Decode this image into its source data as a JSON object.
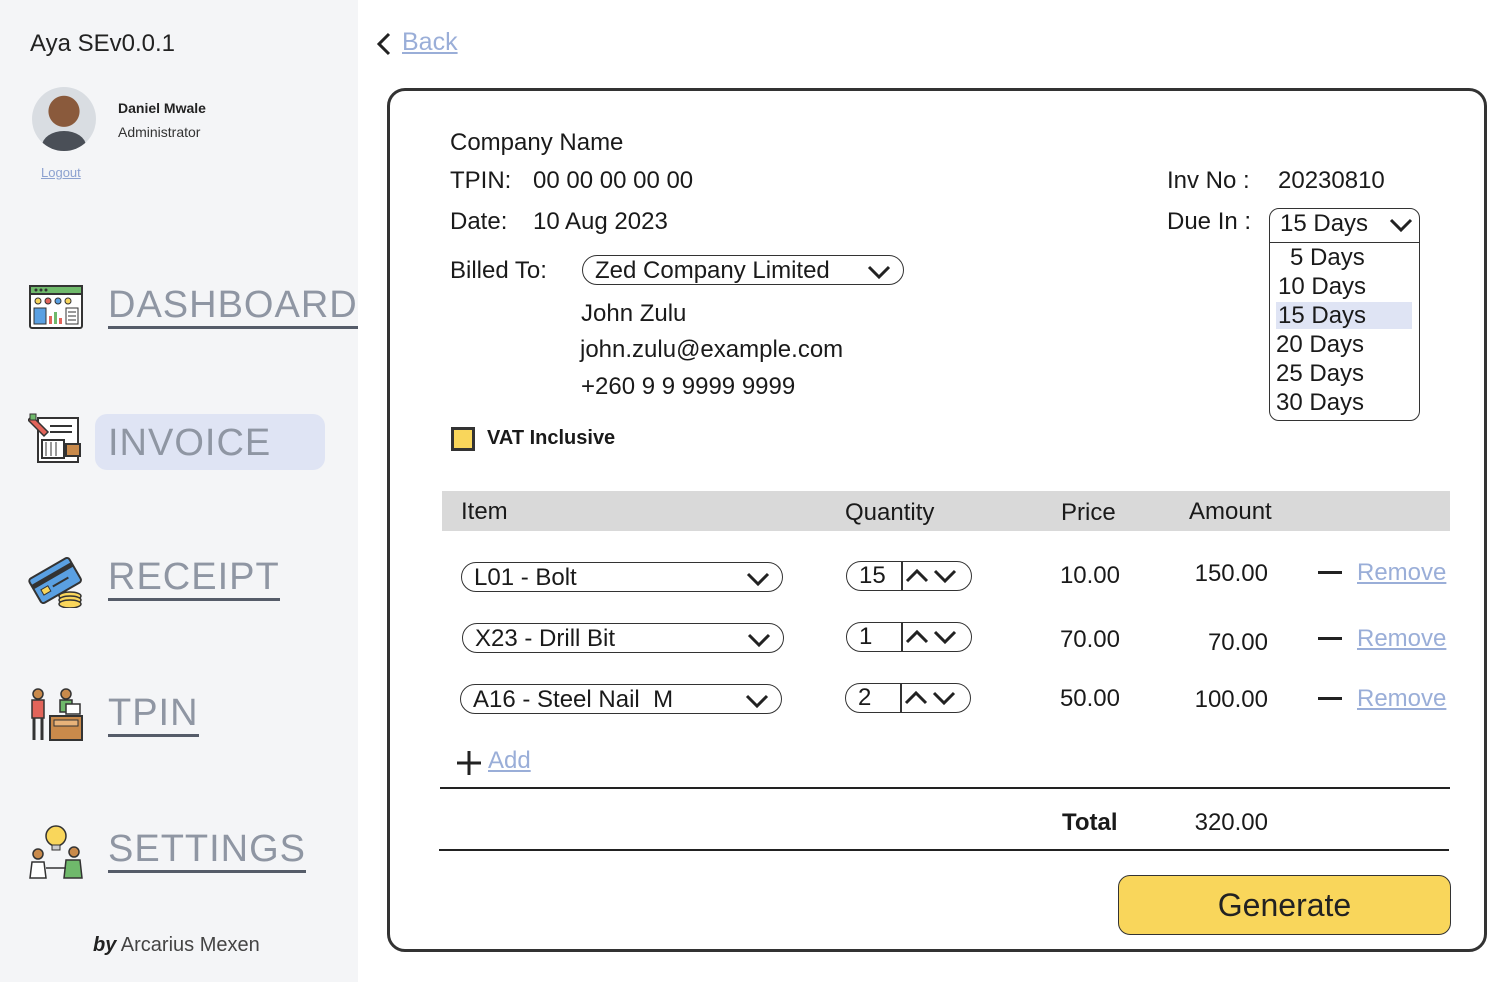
{
  "app": {
    "title": "Aya SEv0.0.1"
  },
  "user": {
    "name": "Daniel Mwale",
    "role": "Administrator",
    "logout_label": "Logout"
  },
  "nav": {
    "dashboard": "DASHBOARD",
    "invoice": "INVOICE",
    "receipt": "RECEIPT",
    "tpin": "TPIN",
    "settings": "SETTINGS",
    "active": "INVOICE"
  },
  "credit": {
    "by": "by",
    "author": "Arcarius Mexen"
  },
  "back_label": "Back",
  "invoice": {
    "company_name": "Company Name",
    "tpin_label": "TPIN:",
    "tpin_value": "00 00 00 00 00",
    "date_label": "Date:",
    "date_value": "10 Aug 2023",
    "inv_no_label": "Inv No :",
    "inv_no_value": "20230810",
    "due_label": "Due In :",
    "due_selected": "15 Days",
    "due_options": [
      "5 Days",
      "10 Days",
      "15 Days",
      "20 Days",
      "25 Days",
      "30 Days"
    ],
    "billed_to_label": "Billed To:",
    "billed_to_value": "Zed Company Limited",
    "contact_name": "John Zulu",
    "contact_email": "john.zulu@example.com",
    "contact_phone": "+260 9 9 9999 9999",
    "vat_label": "VAT Inclusive",
    "vat_checked": true
  },
  "table": {
    "headers": {
      "item": "Item",
      "quantity": "Quantity",
      "price": "Price",
      "amount": "Amount"
    },
    "rows": [
      {
        "item": "L01 - Bolt",
        "qty": "15",
        "price": "10.00",
        "amount": "150.00",
        "remove": "Remove"
      },
      {
        "item": "X23 - Drill Bit",
        "qty": "1",
        "price": "70.00",
        "amount": "70.00",
        "remove": "Remove"
      },
      {
        "item": "A16 - Steel Nail  M",
        "qty": "2",
        "price": "50.00",
        "amount": "100.00",
        "remove": "Remove"
      }
    ],
    "add_label": "Add",
    "total_label": "Total",
    "total_value": "320.00"
  },
  "generate_label": "Generate",
  "colors": {
    "accent_yellow": "#f9d65b",
    "link_blue": "#9aaed8",
    "active_pill": "#dfe4f4",
    "sidebar_bg": "#f4f5f7"
  }
}
